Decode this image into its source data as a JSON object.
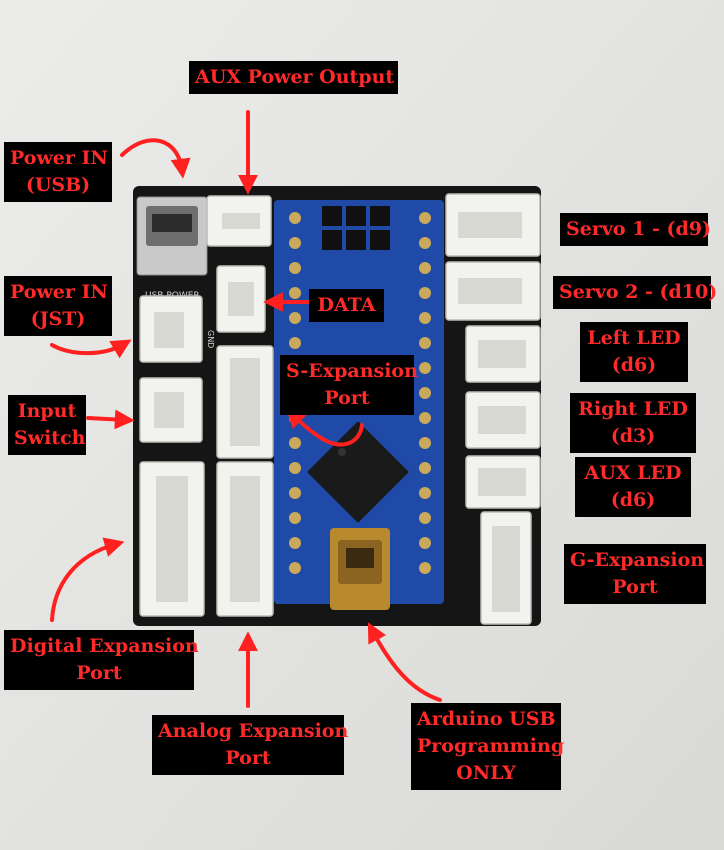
{
  "labels": {
    "aux_power_output": [
      "AUX Power Output"
    ],
    "power_in_usb": [
      "Power IN",
      "(USB)"
    ],
    "power_in_jst": [
      "Power IN",
      "(JST)"
    ],
    "data": [
      "DATA"
    ],
    "input_switch": [
      "Input",
      "Switch"
    ],
    "s_expansion_port": [
      "S-Expansion",
      "Port"
    ],
    "servo1": [
      "Servo 1 - (d9)"
    ],
    "servo2": [
      "Servo 2 - (d10)"
    ],
    "left_led": [
      "Left LED",
      "(d6)"
    ],
    "right_led": [
      "Right LED",
      "(d3)"
    ],
    "aux_led": [
      "AUX LED",
      "(d6)"
    ],
    "g_expansion_port": [
      "G-Expansion",
      "Port"
    ],
    "digital_expansion_port": [
      "Digital Expansion",
      "Port"
    ],
    "analog_expansion_port": [
      "Analog Expansion",
      "Port"
    ],
    "arduino_usb": [
      "Arduino USB",
      "Programming",
      "ONLY"
    ]
  },
  "colors": {
    "label_bg": "#000000",
    "label_text": "#ff2a2a",
    "arrow": "#ff2020",
    "pcb": "#151515",
    "nano": "#1f4aa8",
    "connector": "#f2f2ee",
    "background": "#e6e6e3"
  }
}
